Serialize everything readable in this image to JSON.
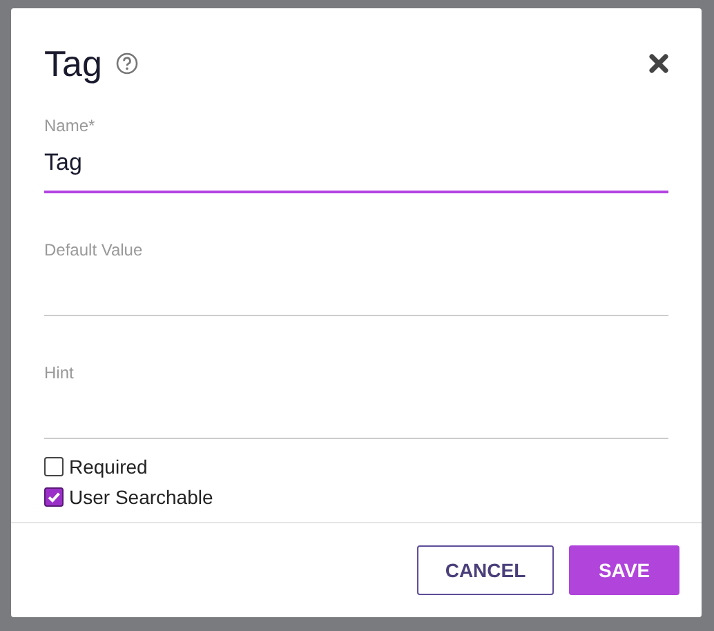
{
  "dialog": {
    "title": "Tag"
  },
  "fields": [
    {
      "label": "Name*",
      "value": "Tag",
      "focused": true
    },
    {
      "label": "Default Value",
      "focused": false
    },
    {
      "label": "Hint",
      "focused": false
    }
  ],
  "checkboxes": [
    {
      "label": "Required",
      "checked": false
    },
    {
      "label": "User Searchable",
      "checked": true
    }
  ],
  "buttons": [
    {
      "label": "CANCEL",
      "kind": "outline"
    },
    {
      "label": "SAVE",
      "kind": "primary"
    }
  ]
}
